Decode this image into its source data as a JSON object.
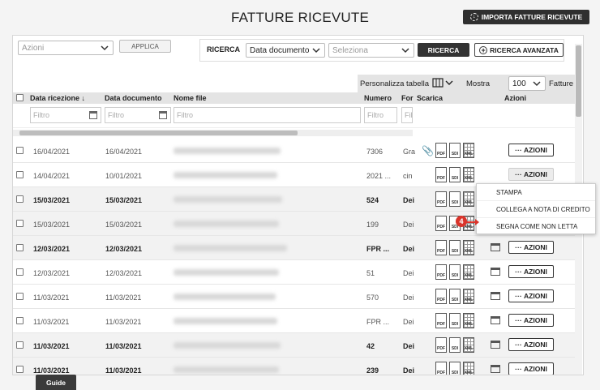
{
  "page": {
    "title": "FATTURE RICEVUTE",
    "import_label": "IMPORTA FATTURE RICEVUTE"
  },
  "actions_bar": {
    "select_placeholder": "Azioni",
    "apply_label": "APPLICA",
    "search_label": "RICERCA",
    "search_field_value": "Data documento",
    "search_value_placeholder": "Seleziona",
    "search_button": "RICERCA",
    "advanced_button": "RICERCA AVANZATA"
  },
  "table_tools": {
    "customize_label": "Personalizza tabella",
    "show_label": "Mostra",
    "page_size": "100",
    "items_label": "Fatture"
  },
  "columns": {
    "ricezione": "Data ricezione",
    "documento": "Data documento",
    "nome": "Nome file",
    "numero": "Numero",
    "fornitore": "For",
    "scarica": "Scarica",
    "azioni": "Azioni"
  },
  "filter_placeholder": "Filtro",
  "icons": {
    "pdf": "PDF",
    "sdi": "SDI",
    "xml": "XML"
  },
  "row_action_label": "AZIONI",
  "rows": [
    {
      "ricezione": "16/04/2021",
      "documento": "16/04/2021",
      "numero": "7306",
      "fornitore": "Gra"
    },
    {
      "ricezione": "14/04/2021",
      "documento": "10/01/2021",
      "numero": "2021 ...",
      "fornitore": "cin"
    },
    {
      "ricezione": "15/03/2021",
      "documento": "15/03/2021",
      "numero": "524",
      "fornitore": "Dei"
    },
    {
      "ricezione": "15/03/2021",
      "documento": "15/03/2021",
      "numero": "199",
      "fornitore": "Dei"
    },
    {
      "ricezione": "12/03/2021",
      "documento": "12/03/2021",
      "numero": "FPR ...",
      "fornitore": "Dei"
    },
    {
      "ricezione": "12/03/2021",
      "documento": "12/03/2021",
      "numero": "51",
      "fornitore": "Dei"
    },
    {
      "ricezione": "11/03/2021",
      "documento": "11/03/2021",
      "numero": "570",
      "fornitore": "Dei"
    },
    {
      "ricezione": "11/03/2021",
      "documento": "11/03/2021",
      "numero": "FPR ...",
      "fornitore": "Dei"
    },
    {
      "ricezione": "11/03/2021",
      "documento": "11/03/2021",
      "numero": "42",
      "fornitore": "Dei"
    },
    {
      "ricezione": "11/03/2021",
      "documento": "11/03/2021",
      "numero": "239",
      "fornitore": "Dei"
    }
  ],
  "context_menu": {
    "item1": "STAMPA",
    "item2": "COLLEGA A NOTA DI CREDITO",
    "item3": "SEGNA COME NON LETTA"
  },
  "step_badge": "4",
  "guide_label": "Guide",
  "colors": {
    "dark": "#333333",
    "badge": "#d9342b"
  }
}
